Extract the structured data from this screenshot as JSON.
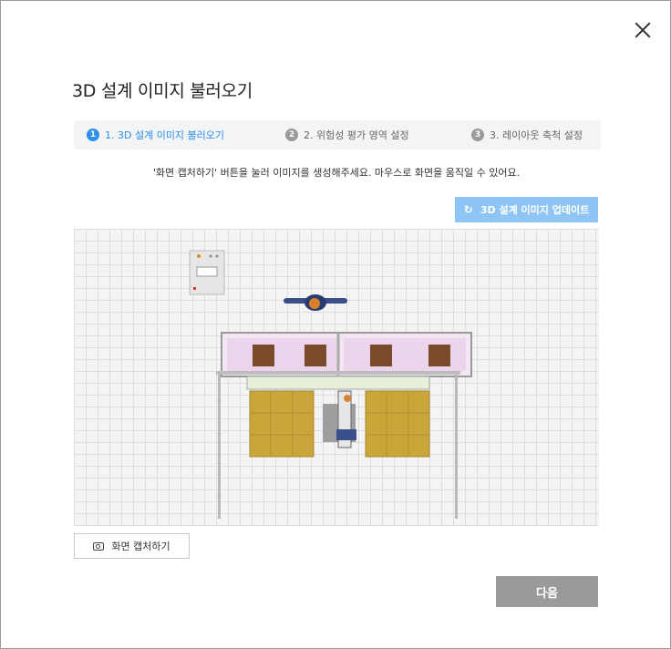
{
  "dialog": {
    "title": "3D 설계 이미지 불러오기"
  },
  "steps": [
    {
      "num": "1",
      "label": "1. 3D 설계 이미지 불러오기",
      "active": true
    },
    {
      "num": "2",
      "label": "2. 위험성 평가 영역 설정",
      "active": false
    },
    {
      "num": "3",
      "label": "3. 레이아웃 축척 설정",
      "active": false
    }
  ],
  "instruction": "'화면 캡처하기' 버튼을 눌러 이미지를 생성해주세요. 마우스로 화면을 움직일 수 있어요.",
  "update_button": {
    "label": "3D 설계 이미지 업데이트",
    "icon": "refresh-icon"
  },
  "capture_button": {
    "label": "화면 캡처하기",
    "icon": "camera-icon"
  },
  "next_button": {
    "label": "다음"
  },
  "colors": {
    "accent": "#2e8fe8",
    "update_button_bg": "#8fc5f4",
    "disabled_button": "#9a9a9a",
    "box": "#7a4b2a",
    "pallet": "#c9a53a",
    "conveyor_pink": "#e8c4e8"
  }
}
